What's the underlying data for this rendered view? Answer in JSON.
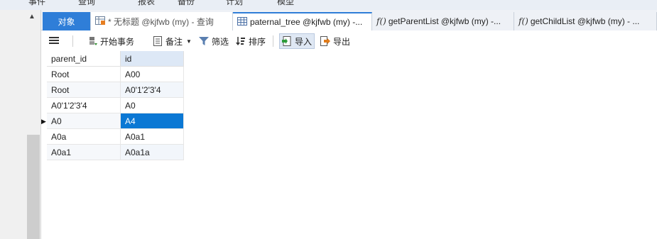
{
  "menu": {
    "items": [
      "事件",
      "查询",
      "报表",
      "备份",
      "计划",
      "模型"
    ]
  },
  "tabs": [
    {
      "label": "对象",
      "kind": "objects"
    },
    {
      "label": "* 无标题 @kjfwb (my) - 查询",
      "kind": "query",
      "icon": "query-table-icon"
    },
    {
      "label": "paternal_tree @kjfwb (my) -...",
      "kind": "table",
      "icon": "table-grid-icon"
    },
    {
      "label": "getParentList @kjfwb (my) -...",
      "kind": "function",
      "icon": "function-icon"
    },
    {
      "label": "getChildList @kjfwb (my) - ...",
      "kind": "function",
      "icon": "function-icon"
    }
  ],
  "function_glyph": "f()",
  "toolbar": {
    "menu_icon": "hamburger-icon",
    "begin_transaction": "开始事务",
    "note": "备注",
    "filter": "筛选",
    "sort": "排序",
    "import": "导入",
    "export": "导出"
  },
  "grid": {
    "columns": [
      "parent_id",
      "id"
    ],
    "rows": [
      [
        "Root",
        "A00"
      ],
      [
        "Root",
        "A0'1'2'3'4"
      ],
      [
        "A0'1'2'3'4",
        "A0"
      ],
      [
        "A0",
        "A4"
      ],
      [
        "A0a",
        "A0a1"
      ],
      [
        "A0a1",
        "A0a1a"
      ]
    ],
    "current_row": 3,
    "selected_column": 1,
    "selection_color": "#0b78d4"
  }
}
